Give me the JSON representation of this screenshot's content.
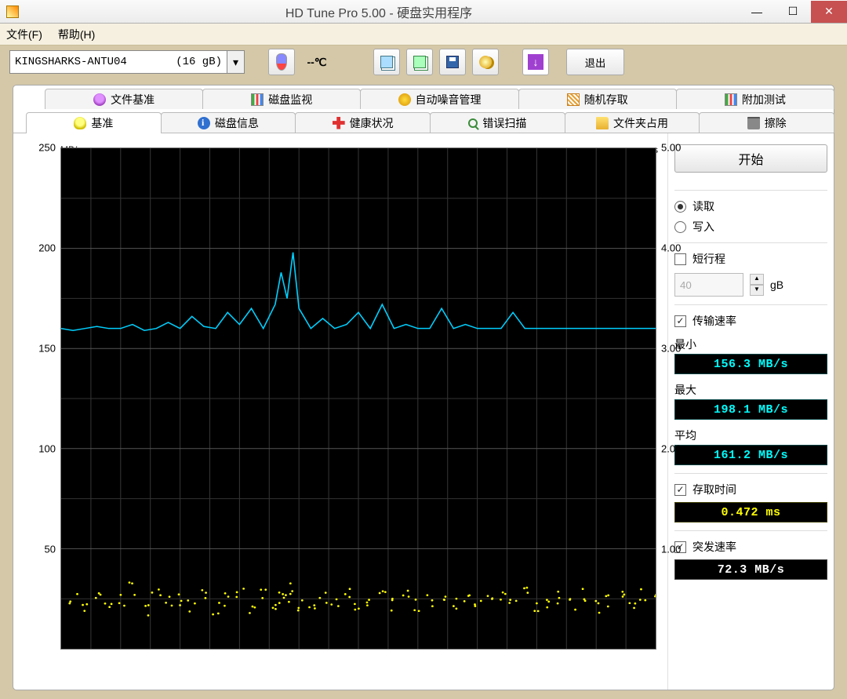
{
  "window": {
    "title": "HD Tune Pro 5.00 - 硬盘实用程序"
  },
  "menu": {
    "file": "文件(F)",
    "help": "帮助(H)"
  },
  "toolbar": {
    "drive_name": "KINGSHARKS-ANTU04",
    "drive_size": "(16 gB)",
    "temp": "--℃",
    "exit": "退出"
  },
  "tabs_top": {
    "file_bench": "文件基准",
    "disk_monitor": "磁盘监视",
    "aam": "自动噪音管理",
    "random": "随机存取",
    "extra": "附加测试"
  },
  "tabs_bottom": {
    "benchmark": "基准",
    "info": "磁盘信息",
    "health": "健康状况",
    "error_scan": "错误扫描",
    "folder": "文件夹占用",
    "erase": "擦除"
  },
  "chart": {
    "left_label": "MB/s",
    "right_label": "ms",
    "left_ticks": [
      "250",
      "200",
      "150",
      "100",
      "50"
    ],
    "right_ticks": [
      "5.00",
      "4.00",
      "3.00",
      "2.00",
      "1.00"
    ]
  },
  "side": {
    "start": "开始",
    "read": "读取",
    "write": "写入",
    "short_stroke": "短行程",
    "stroke_val": "40",
    "stroke_unit": "gB",
    "transfer": "传输速率",
    "min_label": "最小",
    "min_val": "156.3 MB/s",
    "max_label": "最大",
    "max_val": "198.1 MB/s",
    "avg_label": "平均",
    "avg_val": "161.2 MB/s",
    "access": "存取时间",
    "access_val": "0.472 ms",
    "burst": "突发速率",
    "burst_val": "72.3 MB/s"
  },
  "chart_data": {
    "type": "line",
    "title": "",
    "xlabel": "",
    "ylabel_left": "MB/s",
    "ylabel_right": "ms",
    "ylim_left": [
      0,
      250
    ],
    "ylim_right": [
      0,
      5
    ],
    "x_percent": [
      0,
      2,
      4,
      6,
      8,
      10,
      12,
      14,
      16,
      18,
      20,
      22,
      24,
      26,
      28,
      30,
      32,
      34,
      36,
      37,
      38,
      39,
      40,
      42,
      44,
      46,
      48,
      50,
      52,
      54,
      56,
      58,
      60,
      62,
      64,
      66,
      68,
      70,
      72,
      74,
      76,
      78,
      80,
      82,
      84,
      86,
      88,
      90,
      92,
      94,
      96,
      98,
      100
    ],
    "series": [
      {
        "name": "transfer_MBps",
        "axis": "left",
        "values": [
          160,
          159,
          160,
          161,
          160,
          160,
          162,
          159,
          160,
          163,
          160,
          166,
          161,
          160,
          168,
          162,
          170,
          160,
          172,
          188,
          175,
          198,
          170,
          160,
          165,
          160,
          162,
          168,
          160,
          172,
          160,
          162,
          160,
          160,
          170,
          160,
          162,
          160,
          160,
          160,
          168,
          160,
          160,
          160,
          160,
          160,
          160,
          160,
          160,
          160,
          160,
          160,
          160
        ]
      },
      {
        "name": "access_ms",
        "axis": "right",
        "values": [
          0.45,
          0.5,
          0.4,
          0.55,
          0.42,
          0.48,
          0.6,
          0.38,
          0.52,
          0.47,
          0.5,
          0.44,
          0.58,
          0.4,
          0.49,
          0.53,
          0.41,
          0.55,
          0.46,
          0.5,
          0.48,
          0.6,
          0.42,
          0.47,
          0.52,
          0.44,
          0.56,
          0.4,
          0.49,
          0.51,
          0.45,
          0.58,
          0.42,
          0.48,
          0.5,
          0.46,
          0.55,
          0.41,
          0.49,
          0.52,
          0.44,
          0.57,
          0.43,
          0.48,
          0.5,
          0.46,
          0.54,
          0.42,
          0.49,
          0.51,
          0.45,
          0.56,
          0.47
        ]
      }
    ]
  }
}
